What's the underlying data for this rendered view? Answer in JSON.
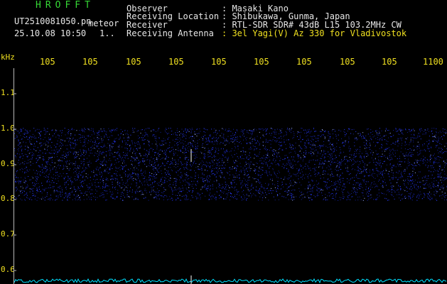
{
  "header": {
    "brand": "HROFFT",
    "file_name": "UT2510081050.pn",
    "mode": "meteor",
    "timestamp": "25.10.08 10:50",
    "extra": "1.."
  },
  "info": {
    "rows": [
      {
        "label": "Observer",
        "value": ": Masaki Kano"
      },
      {
        "label": "Receiving Location",
        "value": ": Shibukawa, Gunma, Japan"
      },
      {
        "label": "Receiver",
        "value": ": RTL-SDR SDR# 43dB L15 103.2MHz CW"
      },
      {
        "label": "Receiving Antenna",
        "value": ": 3el Yagi(V) Az 330 for Vladivostok"
      }
    ]
  },
  "axes": {
    "y_unit": "kHz",
    "y_ticks": [
      "1.1",
      "1.0",
      "0.9",
      "0.8",
      "0.7",
      "0.6"
    ],
    "x_ticks": [
      "105",
      "105",
      "105",
      "105",
      "105",
      "105",
      "105",
      "105",
      "105",
      "1100"
    ]
  },
  "colors": {
    "brand": "#35d835",
    "axis_text": "#f0e020",
    "noise": "#2a3cff",
    "spectrum": "#00e0ff",
    "background": "#000000"
  }
}
